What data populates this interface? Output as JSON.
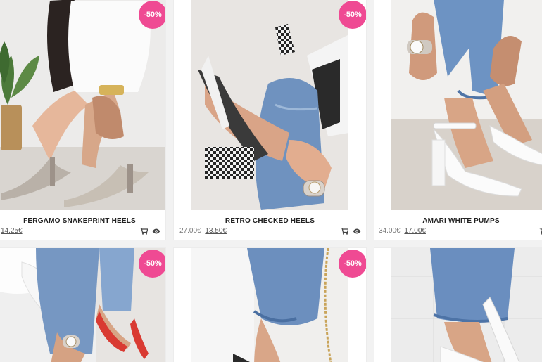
{
  "badge_color": "#ef4a93",
  "products": [
    {
      "name": "FERGAMO SNAKEPRINT HEELS",
      "discount": "-50%",
      "old_price": "",
      "new_price": "14.25€",
      "cart_icon": "cart-icon",
      "view_icon": "eye-icon"
    },
    {
      "name": "RETRO CHECKED HEELS",
      "discount": "-50%",
      "old_price": "27.00€",
      "new_price": "13.50€",
      "cart_icon": "cart-icon",
      "view_icon": "eye-icon"
    },
    {
      "name": "AMARI WHITE PUMPS",
      "discount": "",
      "old_price": "34.00€",
      "new_price": "17.00€",
      "cart_icon": "cart-icon",
      "view_icon": "eye-icon"
    },
    {
      "name": "",
      "discount": "-50%",
      "old_price": "",
      "new_price": ""
    },
    {
      "name": "",
      "discount": "-50%",
      "old_price": "",
      "new_price": ""
    },
    {
      "name": "",
      "discount": "",
      "old_price": "",
      "new_price": ""
    }
  ]
}
